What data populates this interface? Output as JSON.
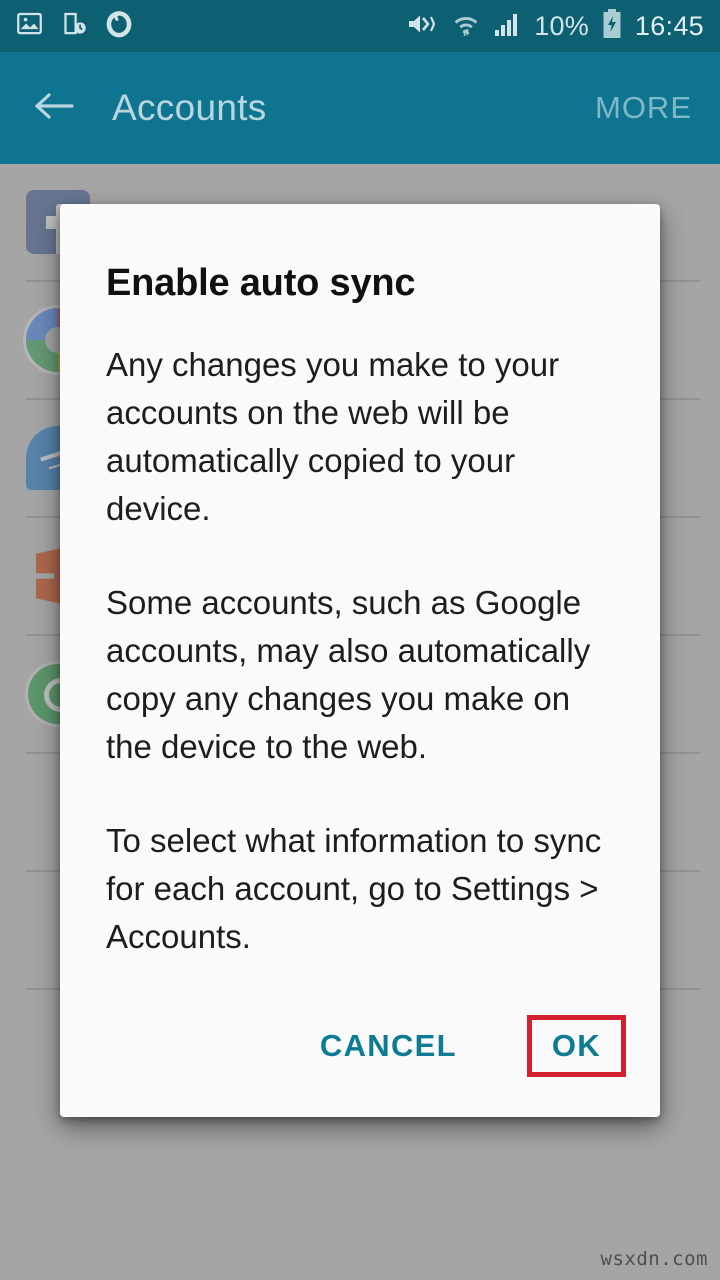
{
  "status_bar": {
    "left_icons": [
      {
        "name": "gallery-image-icon",
        "label": "image"
      },
      {
        "name": "device-clock-icon",
        "label": "device schedule"
      },
      {
        "name": "vodafone-logo-icon",
        "label": "carrier"
      }
    ],
    "right_icons": [
      {
        "name": "mute-vibrate-icon",
        "label": "sound off"
      },
      {
        "name": "wifi-icon",
        "label": "wifi"
      },
      {
        "name": "cellular-signal-icon",
        "label": "signal"
      }
    ],
    "battery_percent": "10%",
    "battery_state": "charging",
    "clock": "16:45",
    "background_color": "#0d5f72",
    "text_color": "#d3e4e9"
  },
  "app_bar": {
    "back_label": "back",
    "title": "Accounts",
    "more_label": "MORE",
    "background_color": "#0e7490",
    "title_color": "#b9d6de"
  },
  "account_list": {
    "rows": [
      {
        "icon": "facebook-icon",
        "name": "facebook"
      },
      {
        "icon": "google-icon",
        "name": "google"
      },
      {
        "icon": "messenger-icon",
        "name": "messenger"
      },
      {
        "icon": "microsoft-office-icon",
        "name": "microsoft-office"
      },
      {
        "icon": "whatsapp-icon",
        "name": "whatsapp"
      },
      {
        "icon": "account-icon",
        "name": "account-6"
      },
      {
        "icon": "account-icon",
        "name": "account-7"
      },
      {
        "icon": "account-icon",
        "name": "account-8"
      }
    ]
  },
  "dialog": {
    "title": "Enable auto sync",
    "paragraphs": [
      "Any changes you make to your accounts on the web will be automatically copied to your device.",
      "Some accounts, such as Google accounts, may also automatically copy any changes you make on the device to the web.",
      "To select what information to sync for each account, go to Settings > Accounts."
    ],
    "cancel_label": "CANCEL",
    "ok_label": "OK",
    "button_color": "#0e7b94",
    "highlight_color": "#d32030",
    "background_color": "#fafafa"
  },
  "watermark": "wsxdn.com"
}
